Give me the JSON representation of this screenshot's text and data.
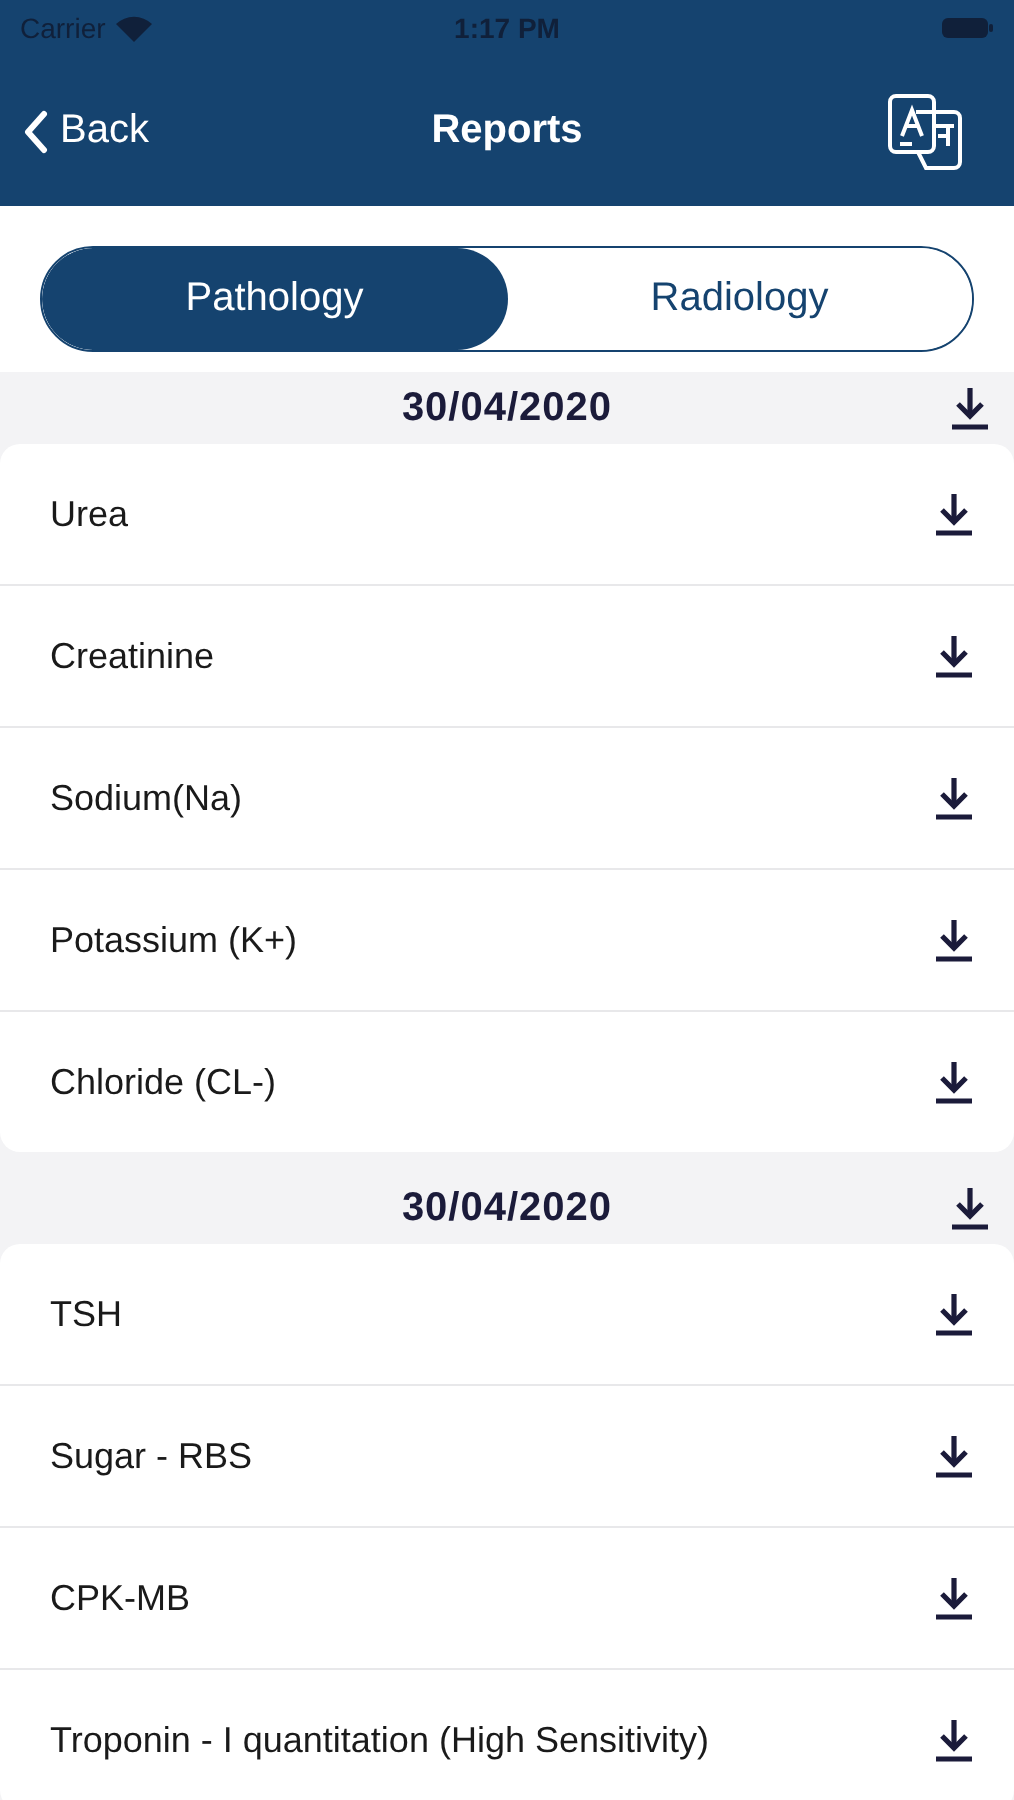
{
  "status_bar": {
    "carrier": "Carrier",
    "time": "1:17 PM"
  },
  "nav": {
    "back": "Back",
    "title": "Reports"
  },
  "tabs": [
    {
      "label": "Pathology",
      "selected": true
    },
    {
      "label": "Radiology",
      "selected": false
    }
  ],
  "sections": [
    {
      "date": "30/04/2020",
      "items": [
        "Urea",
        "Creatinine",
        "Sodium(Na)",
        "Potassium (K+)",
        "Chloride (CL-)"
      ]
    },
    {
      "date": "30/04/2020",
      "items": [
        "TSH",
        "Sugar - RBS",
        "CPK-MB",
        "Troponin - I quantitation (High Sensitivity)"
      ]
    }
  ]
}
